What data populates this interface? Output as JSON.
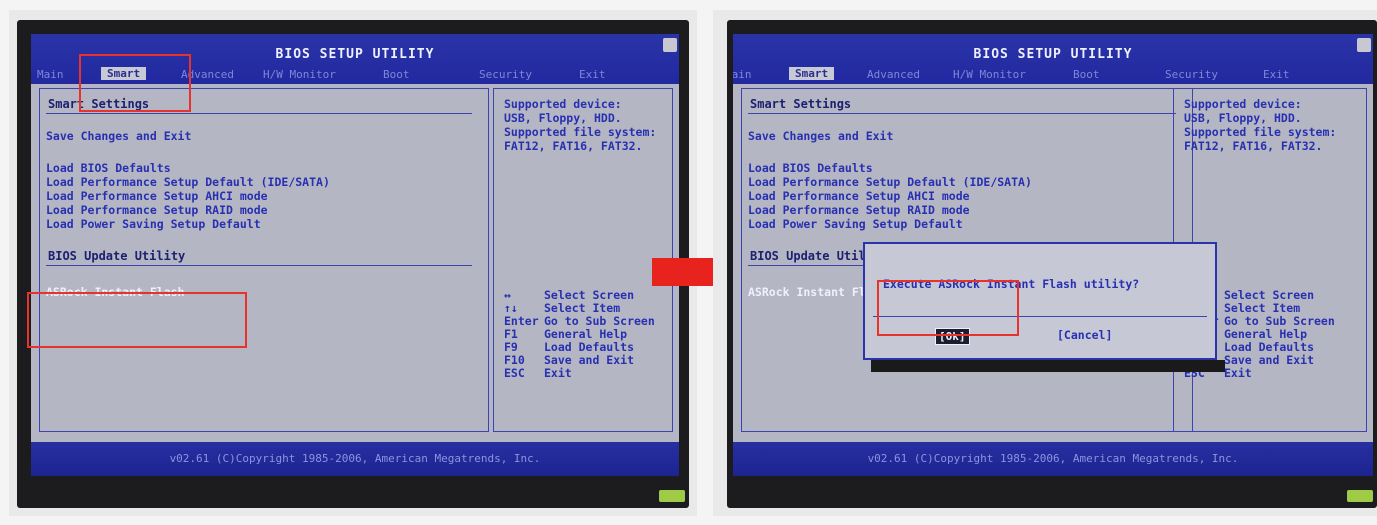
{
  "bios_title": "BIOS SETUP UTILITY",
  "menu": {
    "items": [
      "Main",
      "Smart",
      "Advanced",
      "H/W Monitor",
      "Boot",
      "Security",
      "Exit"
    ],
    "active": "Smart"
  },
  "main": {
    "section_smart": "Smart Settings",
    "save_exit": "Save Changes and Exit",
    "load_items": [
      "Load BIOS Defaults",
      "Load Performance Setup Default (IDE/SATA)",
      "Load Performance Setup AHCI mode",
      "Load Performance Setup RAID mode",
      "Load Power Saving Setup Default"
    ],
    "section_update": "BIOS Update Utility",
    "instant_flash": "ASRock Instant Flash"
  },
  "side": {
    "info": "Supported device:\nUSB, Floppy, HDD.\nSupported file system:\nFAT12, FAT16, FAT32.",
    "keys": [
      {
        "key": "↔",
        "desc": "Select Screen"
      },
      {
        "key": "↑↓",
        "desc": "Select Item"
      },
      {
        "key": "Enter",
        "desc": "Go to Sub Screen"
      },
      {
        "key": "F1",
        "desc": "General Help"
      },
      {
        "key": "F9",
        "desc": "Load Defaults"
      },
      {
        "key": "F10",
        "desc": "Save and Exit"
      },
      {
        "key": "ESC",
        "desc": "Exit"
      }
    ]
  },
  "footer": "v02.61 (C)Copyright 1985-2006, American Megatrends, Inc.",
  "dialog": {
    "message": "Execute ASRock Instant Flash utility?",
    "ok_label": "[Ok]",
    "cancel_label": "[Cancel]"
  },
  "colors": {
    "highlight_box": "#e8332d",
    "bios_blue": "#2b33a8",
    "bios_gray": "#b4b6c4"
  }
}
